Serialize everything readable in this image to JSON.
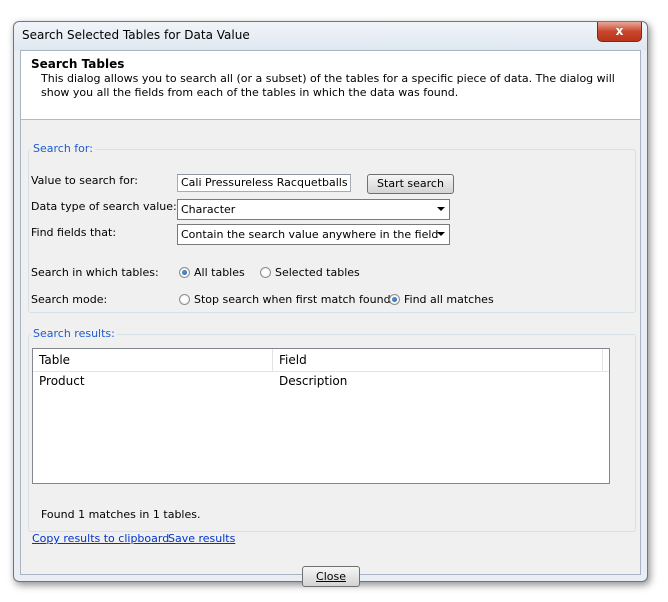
{
  "window": {
    "title": "Search Selected Tables for Data Value",
    "close_glyph": "x"
  },
  "header": {
    "title": "Search Tables",
    "description": "This dialog allows you to search all (or a subset) of the tables for a specific piece of data. The dialog will show you all the fields from each of the tables in which the data was found."
  },
  "search_for": {
    "legend": "Search for:",
    "value_label": "Value to search for:",
    "value": "Cali Pressureless Racquetballs",
    "start_button": "Start search",
    "datatype_label": "Data type of search value:",
    "datatype_selected": "Character",
    "find_label": "Find fields that:",
    "find_selected": "Contain the search value anywhere in the field",
    "tables_label": "Search in which tables:",
    "tables_options": [
      "All tables",
      "Selected tables"
    ],
    "tables_selected": "All tables",
    "mode_label": "Search mode:",
    "mode_options": [
      "Stop search when first match found",
      "Find all matches"
    ],
    "mode_selected": "Find all matches"
  },
  "results": {
    "legend": "Search results:",
    "columns": [
      "Table",
      "Field"
    ],
    "rows": [
      [
        "Product",
        "Description"
      ]
    ],
    "status": "Found 1 matches in 1 tables."
  },
  "links": {
    "copy": "Copy results to clipboard",
    "save": "Save results"
  },
  "footer": {
    "close_button": "Close"
  },
  "colors": {
    "legend_blue": "#1e5ccf",
    "link_blue": "#0033cc"
  }
}
